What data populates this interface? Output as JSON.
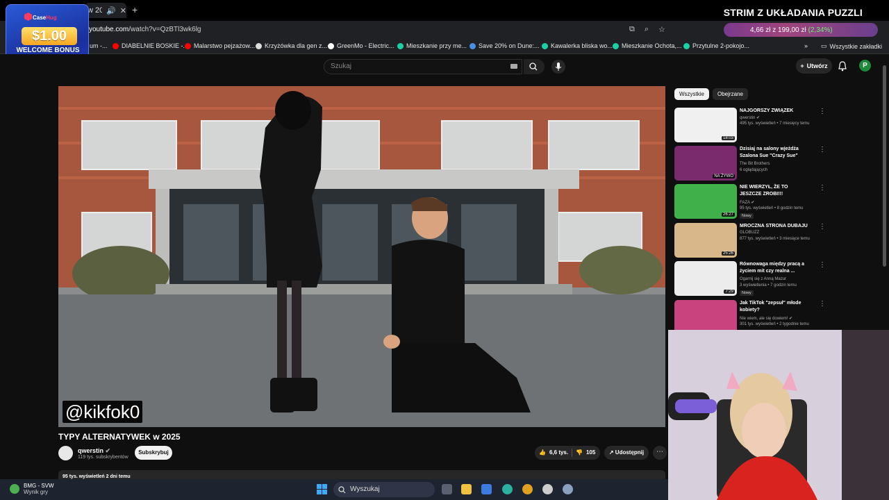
{
  "browser": {
    "tab_title": "w 20",
    "url_host": "youtube.com",
    "url_path": "/watch?v=QzBTl3wk6lg",
    "bookmarks": [
      {
        "label": "um -...",
        "color": "#888888"
      },
      {
        "label": "DIABELNIE BOSKIE -...",
        "color": "#ff0000"
      },
      {
        "label": "Malarstwo pejzażow...",
        "color": "#ff0000"
      },
      {
        "label": "Krzyżówka dla gen z...",
        "color": "#dddddd"
      },
      {
        "label": "GreenMo - Electric...",
        "color": "#ffffff"
      },
      {
        "label": "Mieszkanie przy me...",
        "color": "#1ad1a5"
      },
      {
        "label": "Save 20% on Dune:...",
        "color": "#4a90e2"
      },
      {
        "label": "Kawalerka bliska wo...",
        "color": "#1ad1a5"
      },
      {
        "label": "Mieszkanie Ochota,...",
        "color": "#1ad1a5"
      },
      {
        "label": "Przytulne 2-pokojo...",
        "color": "#1ad1a5"
      }
    ],
    "all_bookmarks": "Wszystkie zakładki",
    "price_widget": {
      "value": "4,66 zł z 199,00 zł",
      "pct": "(2,34%)"
    }
  },
  "stream": {
    "title": "STRIM Z UKŁADANIA PUZZLI",
    "promo_brand_a": "Case",
    "promo_brand_b": "Hug",
    "promo_amount": "$1.00",
    "promo_bonus": "WELCOME BONUS"
  },
  "youtube": {
    "search_placeholder": "Szukaj",
    "create_label": "Utwórz",
    "avatar_letter": "P",
    "watermark": "@kikfok0",
    "video_title": "TYPY ALTERNATYWEK w 2025",
    "channel_name": "qwerstin",
    "subscribers": "119 tys. subskrybentów",
    "subscribe_label": "Subskrybuj",
    "likes": "6,6 tys.",
    "dislikes": "105",
    "share_label": "Udostępnij",
    "description_peek": "95 tys. wyświetleń  2 dni temu",
    "chips": [
      "Wszystkie",
      "Obejrzane"
    ],
    "recommendations": [
      {
        "title": "NAJGORSZY ZWIĄZEK",
        "channel": "qwerstin ✔",
        "meta": "495 tys. wyświetleń • 7 miesięcy temu",
        "duration": "18:03",
        "badge": "",
        "thumb": "#f0f0f0"
      },
      {
        "title": "Dzisiaj na salony wjeżdża Szalona Sue \"Crazy Sue\"",
        "channel": "The Bit Brothers",
        "meta": "6 oglądających",
        "duration": "NA ŻYWO",
        "badge": "",
        "thumb": "#7a2b6e"
      },
      {
        "title": "NIE WIERZYŁ, ŻE TO JESZCZE ZROBI!!!",
        "channel": "FAZA ✔",
        "meta": "95 tys. wyświetleń • 8 godzin temu",
        "duration": "26:27",
        "badge": "Nowy",
        "thumb": "#3fb04a"
      },
      {
        "title": "MROCZNA STRONA DUBAJU",
        "channel": "GLOBUZZ",
        "meta": "877 tys. wyświetleń • 3 miesiące temu",
        "duration": "25:26",
        "badge": "",
        "thumb": "#d8b88a"
      },
      {
        "title": "Równowaga między pracą a życiem mit czy realna ...",
        "channel": "Ogarnij się z Anną Mazur",
        "meta": "3 wyświetlenia • 7 godzin temu",
        "duration": "7:29",
        "badge": "Nowy",
        "thumb": "#ececec"
      },
      {
        "title": "Jak TikTok \"zepsuł\" młode kobiety?",
        "channel": "Nie wiem, ale się dowiem! ✔",
        "meta": "301 tys. wyświetleń • 2 tygodnie temu",
        "duration": "",
        "badge": "",
        "thumb": "#c9447e"
      }
    ]
  },
  "taskbar": {
    "weather_title": "BMG - SVW",
    "weather_sub": "Wynik gry",
    "search_label": "Wyszukaj"
  }
}
